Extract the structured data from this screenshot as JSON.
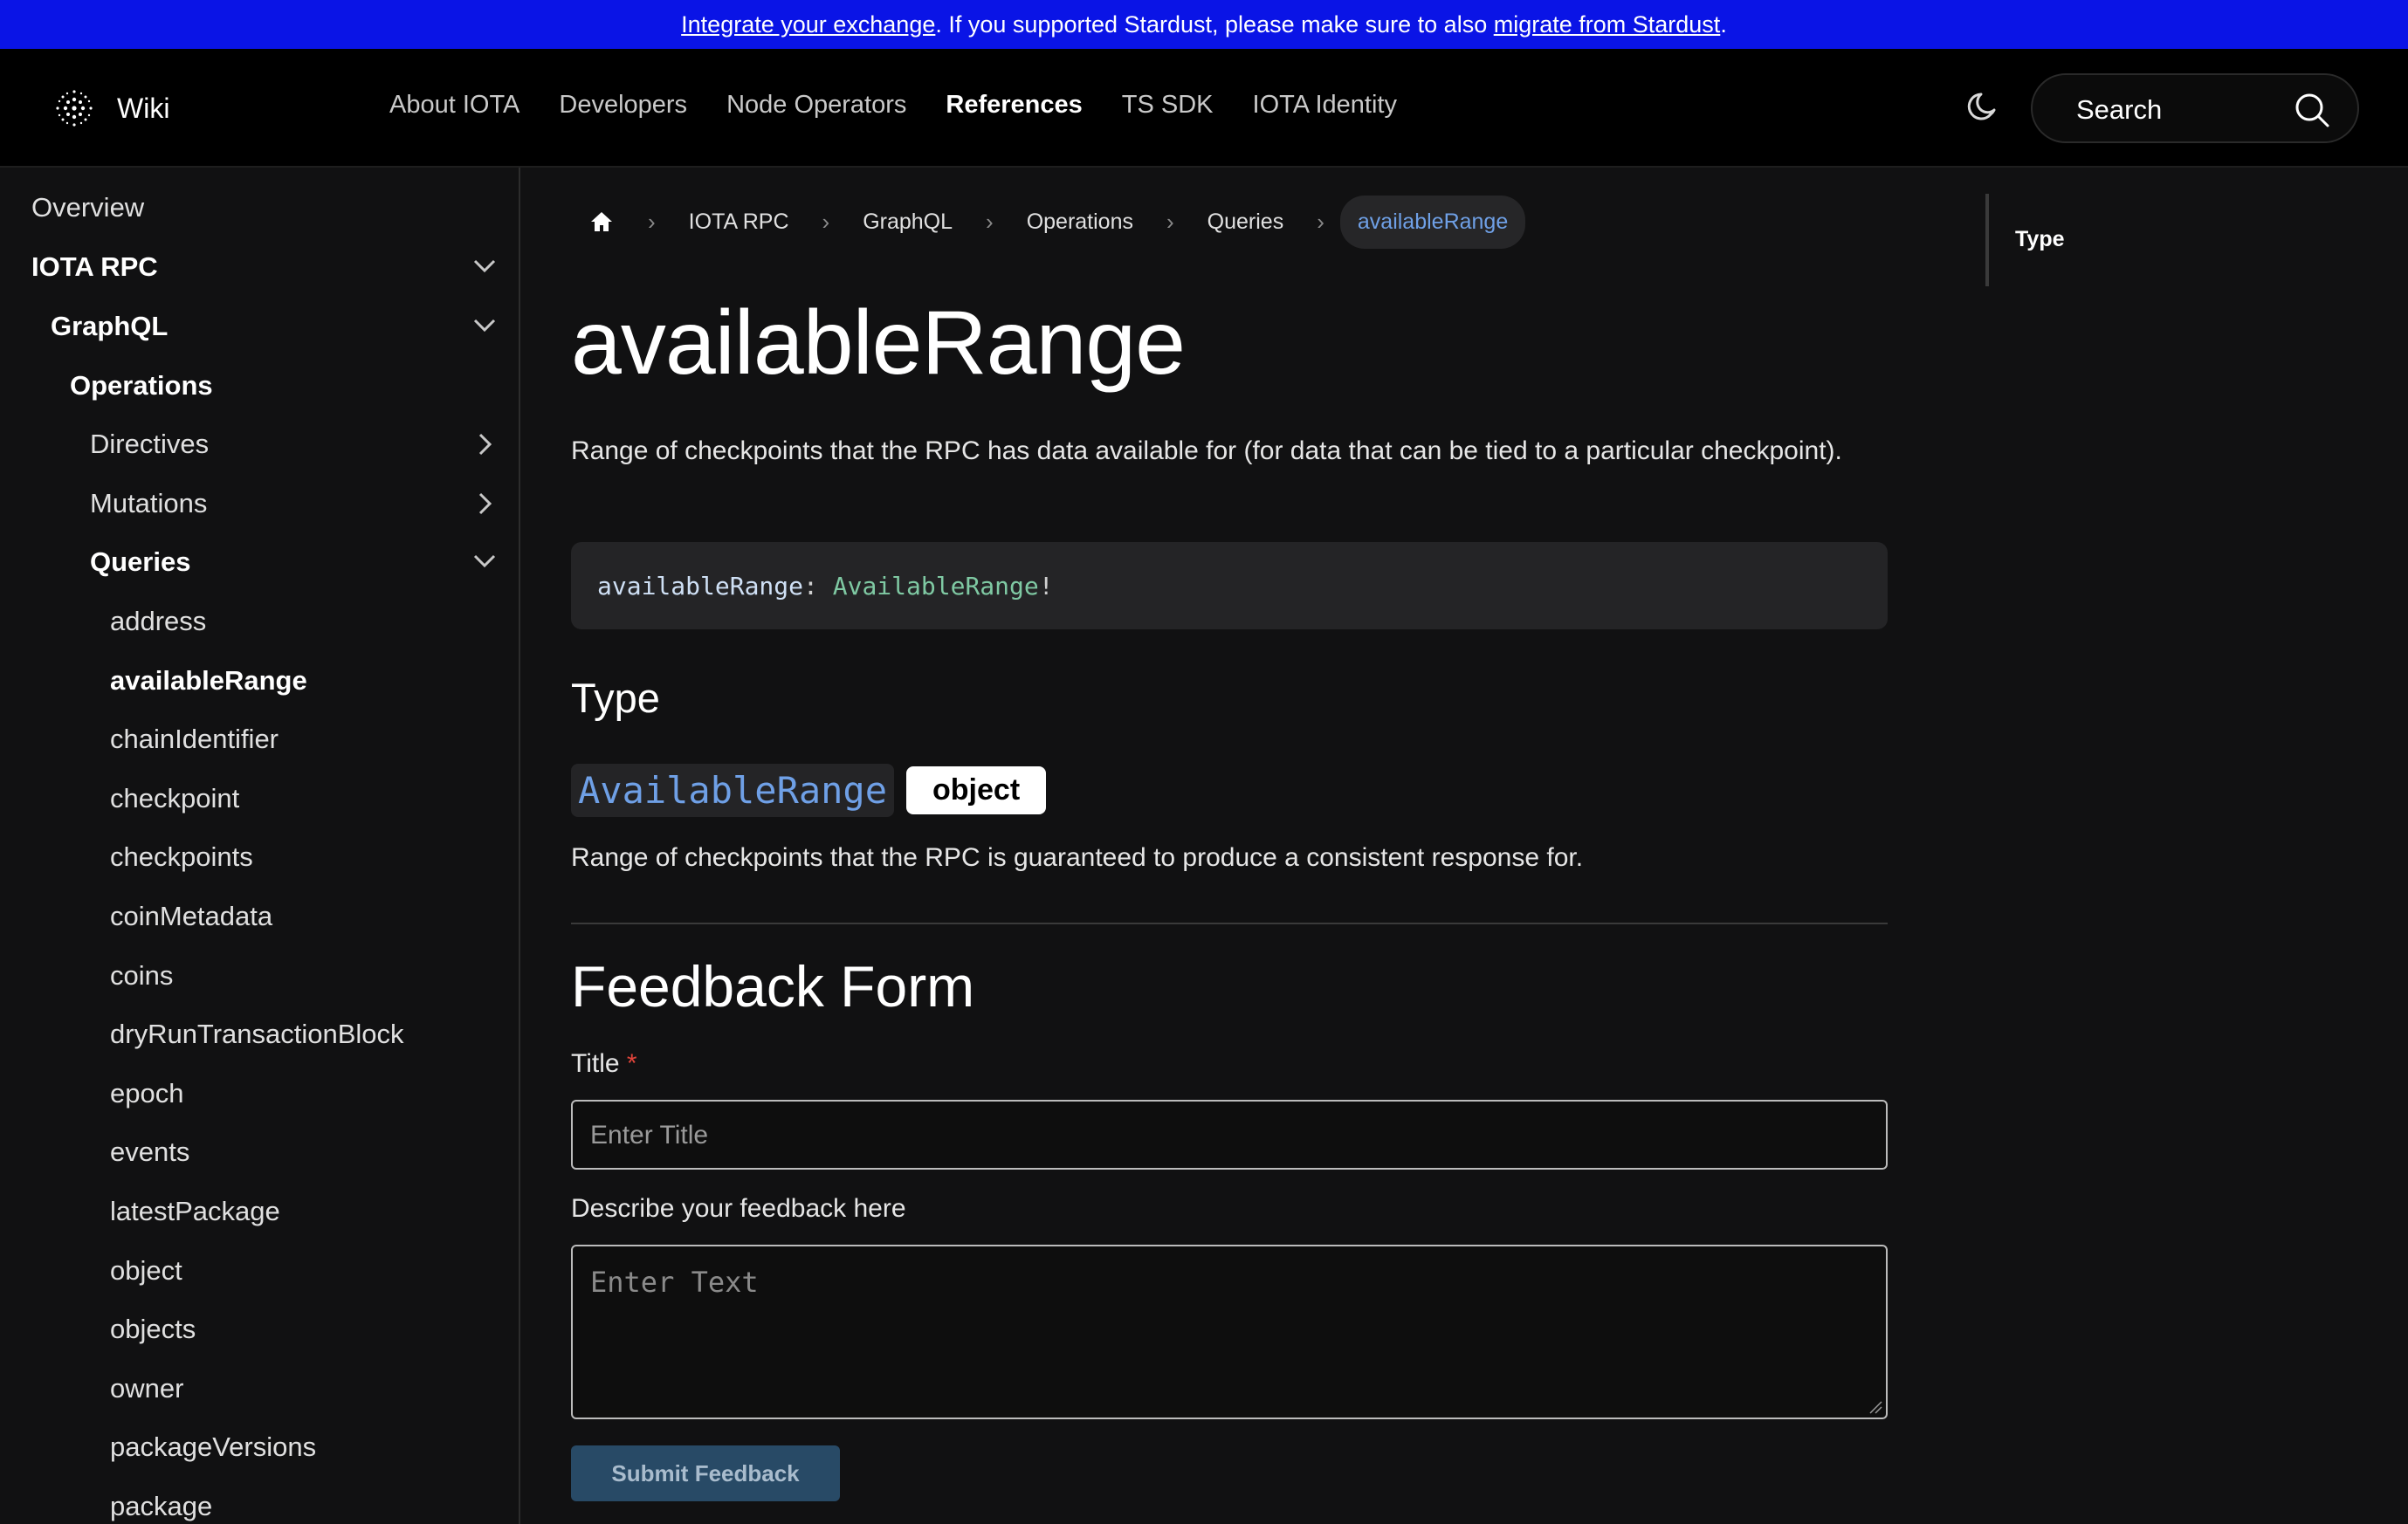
{
  "banner": {
    "link1": "Integrate your exchange",
    "middle": ". If you supported Stardust, please make sure to also ",
    "link2": "migrate from Stardust",
    "end": "."
  },
  "header": {
    "brand": "Wiki",
    "nav": [
      "About IOTA",
      "Developers",
      "Node Operators",
      "References",
      "TS SDK",
      "IOTA Identity"
    ],
    "active_nav": "References",
    "search_label": "Search"
  },
  "sidebar": {
    "items": [
      {
        "label": "Overview"
      },
      {
        "label": "IOTA RPC",
        "chevron": "down"
      },
      {
        "label": "GraphQL",
        "chevron": "down"
      },
      {
        "label": "Operations"
      },
      {
        "label": "Directives",
        "chevron": "right"
      },
      {
        "label": "Mutations",
        "chevron": "right"
      },
      {
        "label": "Queries",
        "chevron": "down"
      },
      {
        "label": "address"
      },
      {
        "label": "availableRange",
        "active": true
      },
      {
        "label": "chainIdentifier"
      },
      {
        "label": "checkpoint"
      },
      {
        "label": "checkpoints"
      },
      {
        "label": "coinMetadata"
      },
      {
        "label": "coins"
      },
      {
        "label": "dryRunTransactionBlock"
      },
      {
        "label": "epoch"
      },
      {
        "label": "events"
      },
      {
        "label": "latestPackage"
      },
      {
        "label": "object"
      },
      {
        "label": "objects"
      },
      {
        "label": "owner"
      },
      {
        "label": "packageVersions"
      },
      {
        "label": "package"
      }
    ]
  },
  "breadcrumbs": [
    "IOTA RPC",
    "GraphQL",
    "Operations",
    "Queries",
    "availableRange"
  ],
  "page": {
    "title": "availableRange",
    "description": "Range of checkpoints that the RPC has data available for (for data that can be tied to a particular checkpoint).",
    "code": {
      "field": "availableRange",
      "colon": ": ",
      "type": "AvailableRange",
      "bang": "!"
    },
    "type_heading": "Type",
    "type_name": "AvailableRange",
    "type_badge": "object",
    "type_description": "Range of checkpoints that the RPC is guaranteed to produce a consistent response for."
  },
  "feedback": {
    "heading": "Feedback Form",
    "title_label": "Title",
    "required_mark": "*",
    "title_placeholder": "Enter Title",
    "body_label": "Describe your feedback here",
    "body_placeholder": "Enter Text",
    "submit": "Submit Feedback"
  },
  "toc": {
    "items": [
      "Type"
    ]
  },
  "colors": {
    "banner_bg": "#0a14e6",
    "link_blue": "#6fa0e6",
    "type_green": "#7fc9a3",
    "submit_bg": "#284a66"
  }
}
